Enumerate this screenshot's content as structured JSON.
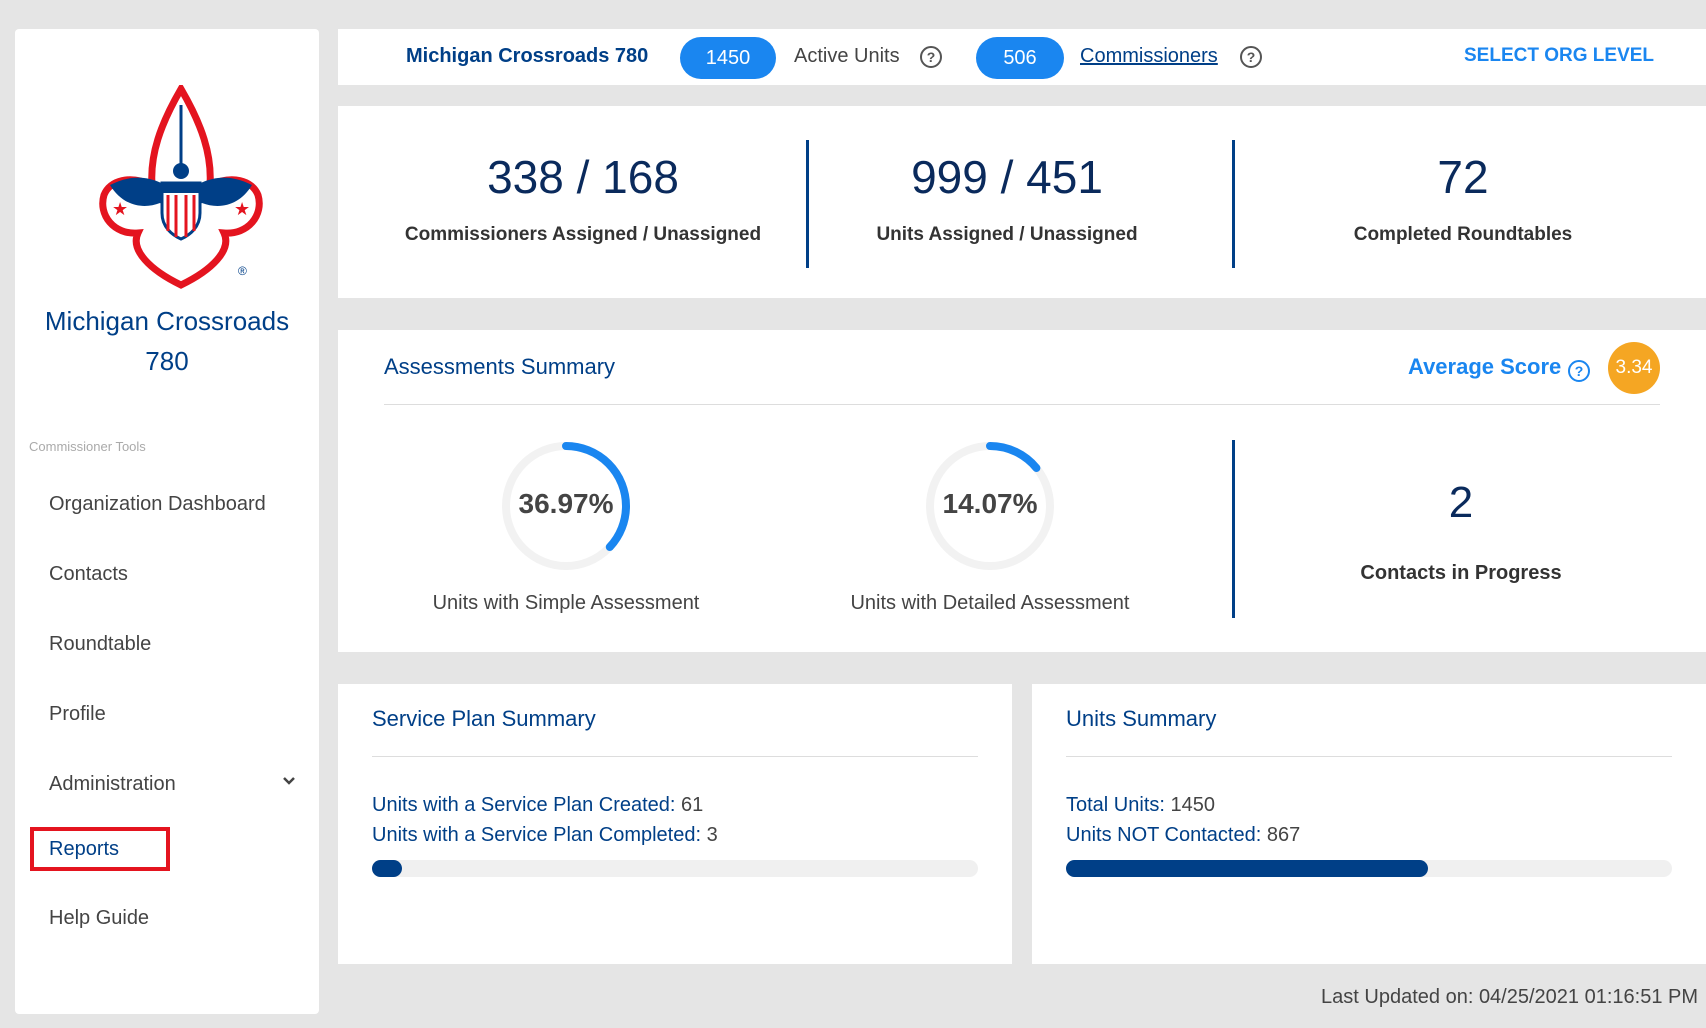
{
  "org": {
    "name_line1": "Michigan Crossroads",
    "name_line2": "780",
    "top_label": "Michigan Crossroads 780"
  },
  "sidebar": {
    "section_label": "Commissioner Tools",
    "items": [
      "Organization Dashboard",
      "Contacts",
      "Roundtable",
      "Profile",
      "Administration",
      "Reports",
      "Help Guide"
    ],
    "highlighted_item": "Reports"
  },
  "topbar": {
    "active_units_count": "1450",
    "active_units_label": "Active Units",
    "commissioners_count": "506",
    "commissioners_label": "Commissioners",
    "help_glyph": "?",
    "select_org_level": "SELECT ORG LEVEL"
  },
  "stats": [
    {
      "value": "338 / 168",
      "label": "Commissioners Assigned / Unassigned"
    },
    {
      "value": "999 / 451",
      "label": "Units Assigned / Unassigned"
    },
    {
      "value": "72",
      "label": "Completed Roundtables"
    }
  ],
  "assessments": {
    "title": "Assessments Summary",
    "average_score_label": "Average Score",
    "average_score": "3.34",
    "simple": {
      "percent": 36.97,
      "value_text": "36.97%",
      "label": "Units with Simple Assessment"
    },
    "detailed": {
      "percent": 14.07,
      "value_text": "14.07%",
      "label": "Units with Detailed Assessment"
    },
    "contacts_in_progress": "2",
    "contacts_label": "Contacts in Progress"
  },
  "service_plan": {
    "title": "Service Plan Summary",
    "created_label": "Units with a Service Plan Created:",
    "created_value": "61",
    "completed_label": "Units with a Service Plan Completed:",
    "completed_value": "3",
    "progress_fraction": 0.049
  },
  "units_summary": {
    "title": "Units Summary",
    "total_label": "Total Units:",
    "total_value": "1450",
    "not_contacted_label": "Units NOT Contacted:",
    "not_contacted_value": "867",
    "progress_fraction": 0.598
  },
  "footer": {
    "last_updated": "Last Updated on: 04/25/2021 01:16:51 PM"
  },
  "colors": {
    "brand_blue": "#003f87",
    "accent_blue": "#1a86f0",
    "badge_orange": "#f5a623",
    "highlight_red": "#e4141f"
  }
}
